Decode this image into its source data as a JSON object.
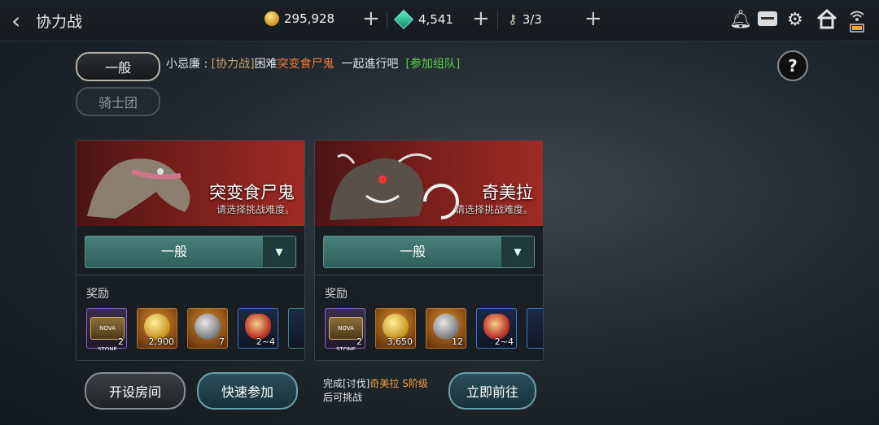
{
  "header": {
    "title": "协力战",
    "gold": "295,928",
    "gems": "4,541",
    "keys": "3/3"
  },
  "tabs": {
    "general": "一般",
    "guild": "骑士团"
  },
  "chat": {
    "speaker": "小忌廉",
    "colon": " : ",
    "tag": "[协力战]",
    "difficulty": "困难",
    "boss": "突变食尸鬼",
    "message": "一起進行吧",
    "join": "[参加组队]"
  },
  "help_label": "?",
  "raids": [
    {
      "name": "突变食尸鬼",
      "subtitle": "请选择挑战难度。",
      "difficulty": "一般",
      "rewards_label": "奖励",
      "rewards": [
        {
          "icon": "nova-stone-icon",
          "count": "2",
          "tier": "purple"
        },
        {
          "icon": "gold-coin-icon",
          "count": "2,900",
          "tier": "orange"
        },
        {
          "icon": "silver-medal-icon",
          "count": "7",
          "tier": "orange"
        },
        {
          "icon": "dragon-egg-icon",
          "count": "2~4",
          "tier": "blue"
        }
      ]
    },
    {
      "name": "奇美拉",
      "subtitle": "请选择挑战难度。",
      "difficulty": "一般",
      "rewards_label": "奖励",
      "rewards": [
        {
          "icon": "nova-stone-icon",
          "count": "2",
          "tier": "purple"
        },
        {
          "icon": "gold-coin-icon",
          "count": "3,650",
          "tier": "orange"
        },
        {
          "icon": "silver-medal-icon",
          "count": "12",
          "tier": "orange"
        },
        {
          "icon": "dragon-egg-icon",
          "count": "2~4",
          "tier": "blue"
        }
      ]
    }
  ],
  "buttons": {
    "create_room": "开设房间",
    "quick_join": "快速参加",
    "go_now": "立即前往"
  },
  "requirement": {
    "prefix": "完成[讨伐]",
    "boss": "奇美拉",
    "grade": "S阶级",
    "suffix": "后可挑战"
  },
  "nova_text": "NOVA STONE",
  "colors": {
    "accent_orange": "#f0a33a",
    "accent_green": "#5bd04a",
    "banner_red": "#7a1f1c",
    "dropdown_teal": "#3e706d"
  }
}
